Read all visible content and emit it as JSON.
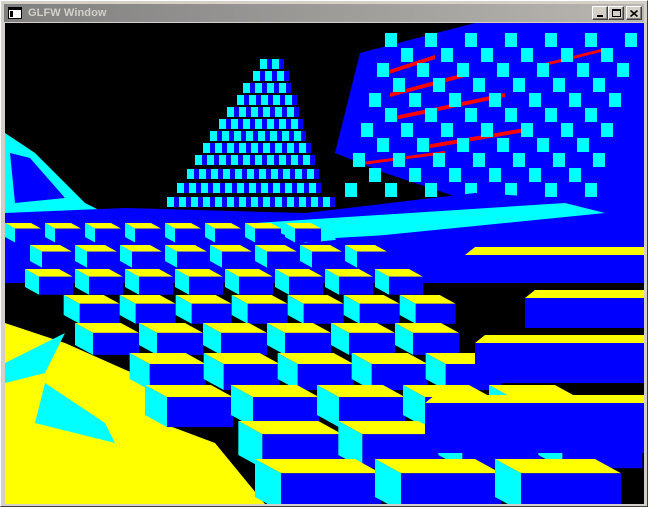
{
  "window": {
    "title": "GLFW Window",
    "icon": "app-window-icon",
    "controls": {
      "minimize": "minimize-icon",
      "maximize": "maximize-icon",
      "close": "close-icon"
    }
  },
  "scene": {
    "description_icon": "voxel-terrain-render",
    "colors": {
      "background": "#000000",
      "top_face": "#ffff00",
      "side_face": "#0000ff",
      "front_face": "#00ffff",
      "edge_highlight": "#ff0000",
      "title_bar": "#808080",
      "title_text": "#d4d0c8",
      "chrome": "#d4d0c8"
    }
  }
}
